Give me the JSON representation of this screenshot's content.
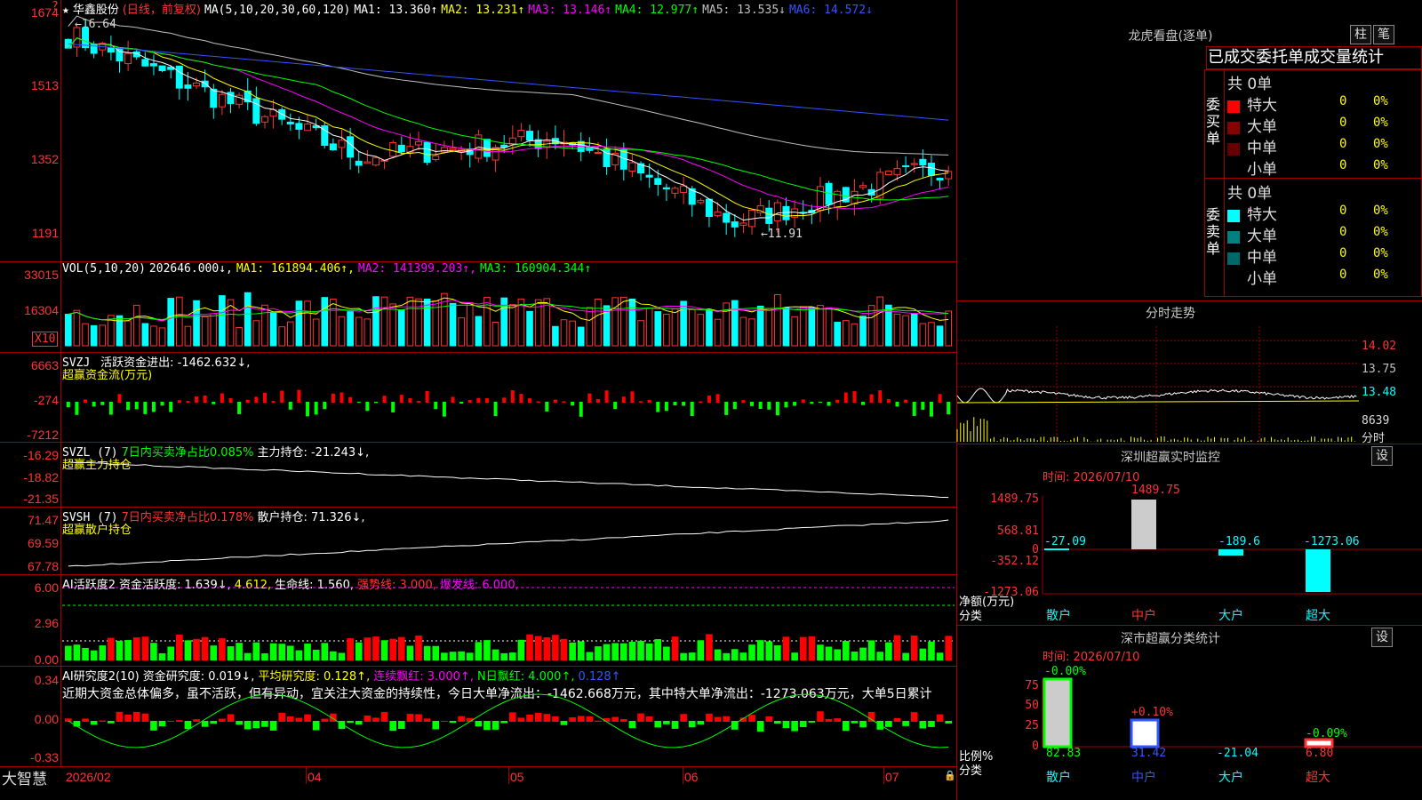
{
  "stock": {
    "name": "华鑫股份",
    "period": "(日线，前复权)",
    "ma_label": "MA(5,10,20,30,60,120)",
    "ma_values": [
      {
        "label": "MA1:",
        "value": "13.360",
        "arrow": "↑",
        "color": "#ffffff"
      },
      {
        "label": "MA2:",
        "value": "13.231",
        "arrow": "↑",
        "color": "#ffff00"
      },
      {
        "label": "MA3:",
        "value": "13.146",
        "arrow": "↑",
        "color": "#ff00ff"
      },
      {
        "label": "MA4:",
        "value": "12.977",
        "arrow": "↑",
        "color": "#00ff00"
      },
      {
        "label": "MA5:",
        "value": "13.535",
        "arrow": "↓",
        "color": "#c0c0c0"
      },
      {
        "label": "MA6:",
        "value": "14.572",
        "arrow": "↓",
        "color": "#3355ff"
      }
    ],
    "high_mark": "16.64",
    "low_mark": "11.91"
  },
  "price_axis": [
    "1674",
    "1513",
    "1352",
    "1191"
  ],
  "vol": {
    "label": "VOL(5,10,20)",
    "value": "202646.000↓,",
    "ma1": "MA1: 161894.406↑,",
    "ma2": "MA2: 141399.203↑,",
    "ma3": "MA3: 160904.344↑",
    "axis": [
      "33015",
      "16304"
    ],
    "unit": "X10"
  },
  "svzj": {
    "label": "SVZJ",
    "desc": "活跃资金进出: -1462.632↓,",
    "sub": "超赢资金流(万元)",
    "axis": [
      "6663",
      "-274",
      "-7212"
    ]
  },
  "svzl": {
    "label": "SVZL (7)",
    "desc1": "7日内买卖净占比0.085%",
    "desc2": "主力持仓: -21.243↓,",
    "sub": "超赢主力持仓",
    "axis": [
      "-16.29",
      "-18.82",
      "-21.35"
    ]
  },
  "svsh": {
    "label": "SVSH (7)",
    "desc1": "7日内买卖净占比0.178%",
    "desc2": "散户持仓: 71.326↓,",
    "sub": "超赢散户持仓",
    "axis": [
      "71.47",
      "69.59",
      "67.78"
    ]
  },
  "ai_active": {
    "label": "AI活跃度2",
    "d1": "资金活跃度: 1.639↓,",
    "d2": "4.612,",
    "d3": "生命线: 1.560,",
    "d4": "强势线: 3.000,",
    "d5": "爆发线: 6.000,",
    "axis": [
      "6.00",
      "2.96",
      "0.00"
    ]
  },
  "ai_research": {
    "label": "AI研究度2(10)",
    "d1": "资金研究度: 0.019↓,",
    "d2": "平均研究度: 0.128↑,",
    "d3": "连续飘红: 3.000↑,",
    "d4": "N日飘红: 4.000↑,",
    "d5": "0.128↑",
    "comment": "近期大资金总体偏多，虽不活跃，但有异动，宜关注大资金的持续性，今日大单净流出：-1462.668万元，其中特大单净流出：-1273.063万元，大单5日累计",
    "axis": [
      "0.34",
      "0.00",
      "-0.33"
    ]
  },
  "x_axis": [
    {
      "label": "2026/02",
      "marker": true
    },
    {
      "label": "04"
    },
    {
      "label": "05"
    },
    {
      "label": "06"
    },
    {
      "label": "07"
    }
  ],
  "brand": "大智慧",
  "dragon": {
    "title": "龙虎看盘(逐单)",
    "btn1": "柱",
    "btn2": "笔",
    "tabs": "已成交委托单成交量统计",
    "buy_side": "委买单",
    "sell_side": "委卖单",
    "buy_total": "共 0单",
    "sell_total": "共 0单",
    "buy_rows": [
      {
        "label": "特大",
        "count": "0",
        "pct": "0%",
        "color": "#ff0000"
      },
      {
        "label": "大单",
        "count": "0",
        "pct": "0%",
        "color": "#880000"
      },
      {
        "label": "中单",
        "count": "0",
        "pct": "0%",
        "color": "#660000"
      },
      {
        "label": "小单",
        "count": "0",
        "pct": "0%",
        "color": "#000000"
      }
    ],
    "sell_rows": [
      {
        "label": "特大",
        "count": "0",
        "pct": "0%",
        "color": "#00ffff"
      },
      {
        "label": "大单",
        "count": "0",
        "pct": "0%",
        "color": "#008080"
      },
      {
        "label": "中单",
        "count": "0",
        "pct": "0%",
        "color": "#006868"
      },
      {
        "label": "小单",
        "count": "0",
        "pct": "0%",
        "color": "#000000"
      }
    ]
  },
  "intraday": {
    "title": "分时走势",
    "axis": [
      "14.02",
      "13.75",
      "13.48"
    ],
    "vol": "8639",
    "unit": "分时"
  },
  "sz_monitor": {
    "title": "深圳超赢实时监控",
    "btn": "设",
    "time": "时间: 2026/07/10",
    "axis": [
      "1489.75",
      "568.81",
      "0",
      "-352.12",
      "-1273.06"
    ],
    "net_label": "净额(万元)",
    "cat_label": "分类",
    "categories": [
      "散户",
      "中户",
      "大户",
      "超大"
    ],
    "values": [
      "-27.09",
      "1489.75",
      "-189.6",
      "-1273.06"
    ]
  },
  "sz_class": {
    "title": "深市超赢分类统计",
    "btn": "设",
    "time": "时间: 2026/07/10",
    "axis": [
      "75",
      "50",
      "25",
      "0"
    ],
    "ratio_label": "比例%",
    "cat_label": "分类",
    "categories": [
      "散户",
      "中户",
      "大户",
      "超大"
    ],
    "pcts": [
      "82.83",
      "31.42",
      "-21.04",
      "6.80"
    ],
    "changes": [
      "-0.00%",
      "+0.10%",
      "",
      "-0.09%"
    ]
  }
}
